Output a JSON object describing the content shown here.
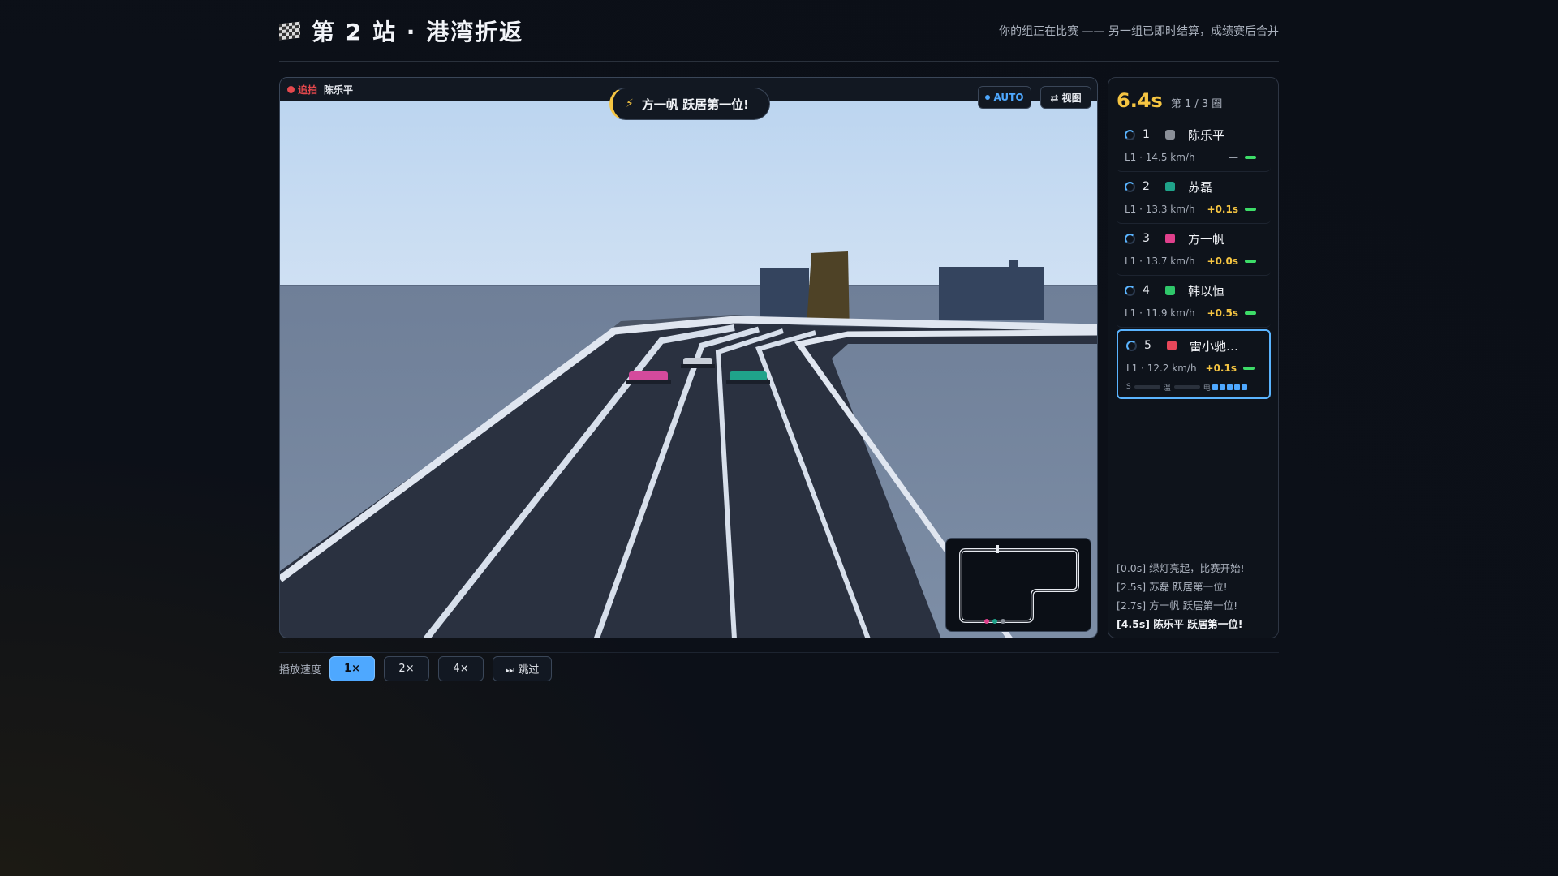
{
  "header": {
    "title": "第 2 站 · 港湾折返",
    "subtitle": "你的组正在比赛 —— 另一组已即时结算，成绩赛后合并"
  },
  "viewport": {
    "chase_label": "追拍",
    "chase_name": "陈乐平",
    "toast_icon": "⚡",
    "toast_text": "方一帆 跃居第一位!",
    "auto_label": "AUTO",
    "view_label": "⇄ 视图"
  },
  "sidebar": {
    "timer": "6.4s",
    "lap_text": "第 1 / 3 圈",
    "racers": [
      {
        "pos": "1",
        "name": "陈乐平",
        "color": "#8a8f98",
        "stats": "L1 · 14.5 km/h",
        "gap": "—"
      },
      {
        "pos": "2",
        "name": "苏磊",
        "color": "#1fa38a",
        "stats": "L1 · 13.3 km/h",
        "gap": "+0.1s"
      },
      {
        "pos": "3",
        "name": "方一帆",
        "color": "#e0408c",
        "stats": "L1 · 13.7 km/h",
        "gap": "+0.0s"
      },
      {
        "pos": "4",
        "name": "韩以恒",
        "color": "#2fc76a",
        "stats": "L1 · 11.9 km/h",
        "gap": "+0.5s"
      },
      {
        "pos": "5",
        "name": "雷小驰…",
        "color": "#e8475a",
        "stats": "L1 · 12.2 km/h",
        "gap": "+0.1s"
      }
    ],
    "active_detail": {
      "s_label": "S",
      "temp_label": "温",
      "power_label": "电"
    },
    "log": [
      "[0.0s] 绿灯亮起，比赛开始!",
      "[2.5s] 苏磊 跃居第一位!",
      "[2.7s] 方一帆 跃居第一位!",
      "[4.5s] 陈乐平 跃居第一位!"
    ]
  },
  "controls": {
    "label": "播放速度",
    "buttons": [
      "1×",
      "2×",
      "4×",
      "⏭ 跳过"
    ],
    "active_index": 0
  }
}
